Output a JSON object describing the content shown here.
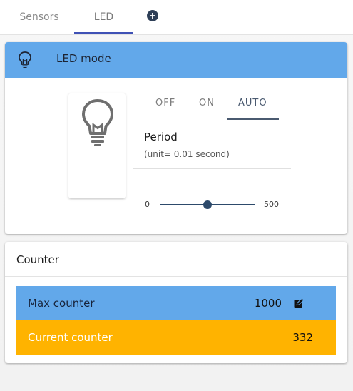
{
  "tabs": {
    "items": [
      {
        "label": "Sensors",
        "active": false
      },
      {
        "label": "LED",
        "active": true
      }
    ],
    "add_icon": "plus-circle-icon",
    "accent": "#3f51b5"
  },
  "led_card": {
    "header_icon": "lightbulb-icon",
    "title": "LED mode",
    "header_color": "#62a8ea",
    "bulb_icon": "lightbulb-large-icon",
    "modes": [
      "OFF",
      "ON",
      "AUTO"
    ],
    "selected_mode": "AUTO",
    "period": {
      "title": "Period",
      "unit": "(unit= 0.01 second)"
    },
    "slider": {
      "min_label": "0",
      "max_label": "500",
      "value_fraction": 0.5
    }
  },
  "counter_card": {
    "title": "Counter",
    "max": {
      "label": "Max counter",
      "value": "1000",
      "color": "#62a8ea",
      "edit_icon": "edit-icon"
    },
    "current": {
      "label": "Current counter",
      "value": "332",
      "color": "#ffb300"
    }
  }
}
